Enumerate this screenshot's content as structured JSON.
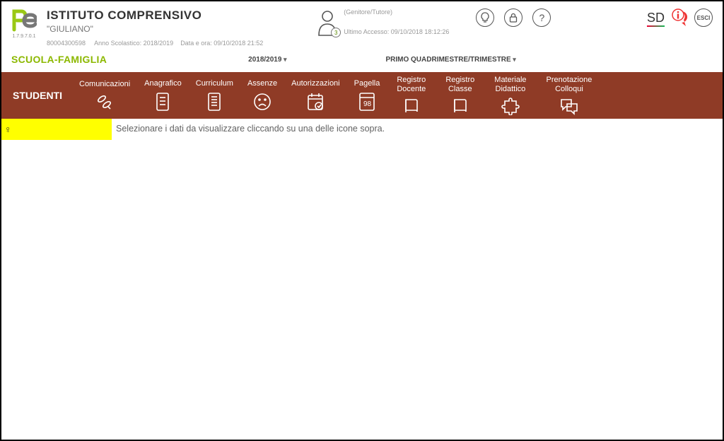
{
  "logo": {
    "version": "1.7.9.7.0.1"
  },
  "institution": {
    "title": "ISTITUTO COMPRENSIVO",
    "subtitle": "\"GIULIANO\"",
    "code": "80004300598",
    "school_year_label": "Anno Scolastico: 2018/2019",
    "datetime_label": "Data e ora: 09/10/2018 21:52"
  },
  "user": {
    "role": "(Genitore/Tutore)",
    "badge": "3",
    "last_access": "Ultimo Accesso: 09/10/2018 18:12:26"
  },
  "top_icons": {
    "hint": "?",
    "sd": "SD",
    "esci": "ESCI"
  },
  "subheader": {
    "title": "SCUOLA-FAMIGLIA",
    "year": "2018/2019",
    "period": "PRIMO QUADRIMESTRE/TRIMESTRE"
  },
  "nav": {
    "first": "STUDENTI",
    "items": [
      {
        "label": "Comunicazioni"
      },
      {
        "label": "Anagrafico"
      },
      {
        "label": "Curriculum"
      },
      {
        "label": "Assenze"
      },
      {
        "label": "Autorizzazioni"
      },
      {
        "label": "Pagella"
      },
      {
        "label": "Registro\nDocente"
      },
      {
        "label": "Registro\nClasse"
      },
      {
        "label": "Materiale\nDidattico"
      },
      {
        "label": "Prenotazione\nColloqui"
      }
    ]
  },
  "content": {
    "gender_symbol": "♀",
    "hint": "Selezionare i dati da visualizzare cliccando su una delle icone sopra."
  }
}
